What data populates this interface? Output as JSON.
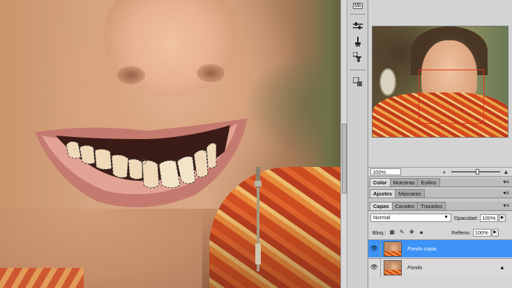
{
  "colors": {
    "selection": "#3d94f6",
    "panel": "#c9c9c9",
    "view_rect": "#e0301e"
  },
  "dock": {
    "top_label": "Mb",
    "buttons": [
      "adjust-icon",
      "brush-presets-icon",
      "clone-source-icon",
      "history-icon"
    ]
  },
  "navigator": {
    "zoom": "100%"
  },
  "color_tabs": [
    "Color",
    "Muestras",
    "Estilos"
  ],
  "adjust_tabs": [
    "Ajustes",
    "Máscaras"
  ],
  "layers_tabs": [
    "Capas",
    "Canales",
    "Trazados"
  ],
  "layers": {
    "blend_mode": "Normal",
    "opacity_label": "Opacidad:",
    "opacity_value": "100%",
    "lock_label": "Bloq.:",
    "fill_label": "Relleno:",
    "fill_value": "100%",
    "items": [
      {
        "name": "Fondo copia",
        "selected": true
      },
      {
        "name": "Fondo",
        "selected": false
      }
    ]
  }
}
